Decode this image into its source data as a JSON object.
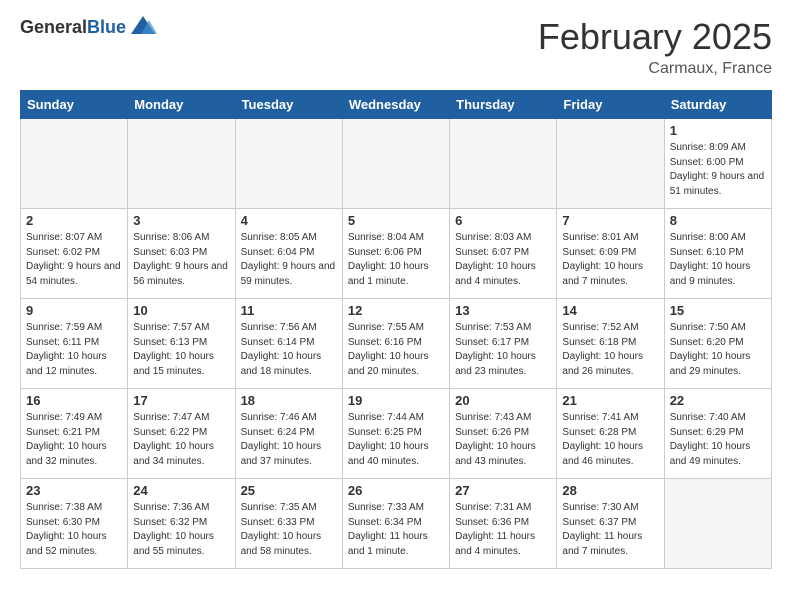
{
  "header": {
    "logo_general": "General",
    "logo_blue": "Blue",
    "month_title": "February 2025",
    "location": "Carmaux, France"
  },
  "days_of_week": [
    "Sunday",
    "Monday",
    "Tuesday",
    "Wednesday",
    "Thursday",
    "Friday",
    "Saturday"
  ],
  "weeks": [
    [
      {
        "num": "",
        "info": ""
      },
      {
        "num": "",
        "info": ""
      },
      {
        "num": "",
        "info": ""
      },
      {
        "num": "",
        "info": ""
      },
      {
        "num": "",
        "info": ""
      },
      {
        "num": "",
        "info": ""
      },
      {
        "num": "1",
        "info": "Sunrise: 8:09 AM\nSunset: 6:00 PM\nDaylight: 9 hours and 51 minutes."
      }
    ],
    [
      {
        "num": "2",
        "info": "Sunrise: 8:07 AM\nSunset: 6:02 PM\nDaylight: 9 hours and 54 minutes."
      },
      {
        "num": "3",
        "info": "Sunrise: 8:06 AM\nSunset: 6:03 PM\nDaylight: 9 hours and 56 minutes."
      },
      {
        "num": "4",
        "info": "Sunrise: 8:05 AM\nSunset: 6:04 PM\nDaylight: 9 hours and 59 minutes."
      },
      {
        "num": "5",
        "info": "Sunrise: 8:04 AM\nSunset: 6:06 PM\nDaylight: 10 hours and 1 minute."
      },
      {
        "num": "6",
        "info": "Sunrise: 8:03 AM\nSunset: 6:07 PM\nDaylight: 10 hours and 4 minutes."
      },
      {
        "num": "7",
        "info": "Sunrise: 8:01 AM\nSunset: 6:09 PM\nDaylight: 10 hours and 7 minutes."
      },
      {
        "num": "8",
        "info": "Sunrise: 8:00 AM\nSunset: 6:10 PM\nDaylight: 10 hours and 9 minutes."
      }
    ],
    [
      {
        "num": "9",
        "info": "Sunrise: 7:59 AM\nSunset: 6:11 PM\nDaylight: 10 hours and 12 minutes."
      },
      {
        "num": "10",
        "info": "Sunrise: 7:57 AM\nSunset: 6:13 PM\nDaylight: 10 hours and 15 minutes."
      },
      {
        "num": "11",
        "info": "Sunrise: 7:56 AM\nSunset: 6:14 PM\nDaylight: 10 hours and 18 minutes."
      },
      {
        "num": "12",
        "info": "Sunrise: 7:55 AM\nSunset: 6:16 PM\nDaylight: 10 hours and 20 minutes."
      },
      {
        "num": "13",
        "info": "Sunrise: 7:53 AM\nSunset: 6:17 PM\nDaylight: 10 hours and 23 minutes."
      },
      {
        "num": "14",
        "info": "Sunrise: 7:52 AM\nSunset: 6:18 PM\nDaylight: 10 hours and 26 minutes."
      },
      {
        "num": "15",
        "info": "Sunrise: 7:50 AM\nSunset: 6:20 PM\nDaylight: 10 hours and 29 minutes."
      }
    ],
    [
      {
        "num": "16",
        "info": "Sunrise: 7:49 AM\nSunset: 6:21 PM\nDaylight: 10 hours and 32 minutes."
      },
      {
        "num": "17",
        "info": "Sunrise: 7:47 AM\nSunset: 6:22 PM\nDaylight: 10 hours and 34 minutes."
      },
      {
        "num": "18",
        "info": "Sunrise: 7:46 AM\nSunset: 6:24 PM\nDaylight: 10 hours and 37 minutes."
      },
      {
        "num": "19",
        "info": "Sunrise: 7:44 AM\nSunset: 6:25 PM\nDaylight: 10 hours and 40 minutes."
      },
      {
        "num": "20",
        "info": "Sunrise: 7:43 AM\nSunset: 6:26 PM\nDaylight: 10 hours and 43 minutes."
      },
      {
        "num": "21",
        "info": "Sunrise: 7:41 AM\nSunset: 6:28 PM\nDaylight: 10 hours and 46 minutes."
      },
      {
        "num": "22",
        "info": "Sunrise: 7:40 AM\nSunset: 6:29 PM\nDaylight: 10 hours and 49 minutes."
      }
    ],
    [
      {
        "num": "23",
        "info": "Sunrise: 7:38 AM\nSunset: 6:30 PM\nDaylight: 10 hours and 52 minutes."
      },
      {
        "num": "24",
        "info": "Sunrise: 7:36 AM\nSunset: 6:32 PM\nDaylight: 10 hours and 55 minutes."
      },
      {
        "num": "25",
        "info": "Sunrise: 7:35 AM\nSunset: 6:33 PM\nDaylight: 10 hours and 58 minutes."
      },
      {
        "num": "26",
        "info": "Sunrise: 7:33 AM\nSunset: 6:34 PM\nDaylight: 11 hours and 1 minute."
      },
      {
        "num": "27",
        "info": "Sunrise: 7:31 AM\nSunset: 6:36 PM\nDaylight: 11 hours and 4 minutes."
      },
      {
        "num": "28",
        "info": "Sunrise: 7:30 AM\nSunset: 6:37 PM\nDaylight: 11 hours and 7 minutes."
      },
      {
        "num": "",
        "info": ""
      }
    ]
  ]
}
